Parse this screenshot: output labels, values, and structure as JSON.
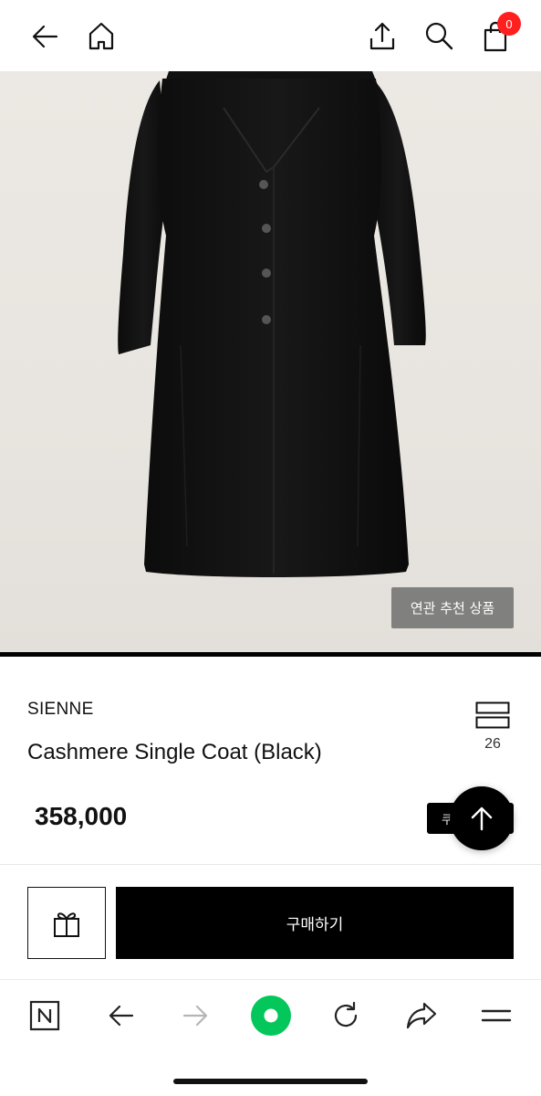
{
  "topbar": {
    "back_icon": "arrow-left-icon",
    "home_icon": "home-icon",
    "share_icon": "share-upload-icon",
    "search_icon": "search-icon",
    "cart_icon": "shopping-bag-icon",
    "cart_count": "0",
    "badge_color": "#ff1f1f"
  },
  "hero": {
    "related_label": "연관 추천 상품"
  },
  "product": {
    "brand": "SIENNE",
    "title": "Cashmere Single Coat (Black)",
    "price": "358,000",
    "like_count": "26",
    "like_icon": "stacked-bars-icon",
    "coupon_label": "쿠폰받기"
  },
  "scroll_top": {
    "icon": "arrow-up-icon"
  },
  "purchase": {
    "gift_icon": "gift-icon",
    "buy_label": "구매하기"
  },
  "browser": {
    "items": [
      {
        "icon": "naver-n-icon"
      },
      {
        "icon": "arrow-left-icon"
      },
      {
        "icon": "arrow-right-icon"
      },
      {
        "icon": "green-circle-icon"
      },
      {
        "icon": "refresh-icon"
      },
      {
        "icon": "share-arrow-icon"
      },
      {
        "icon": "menu-icon"
      }
    ],
    "accent": "#03c75a"
  }
}
